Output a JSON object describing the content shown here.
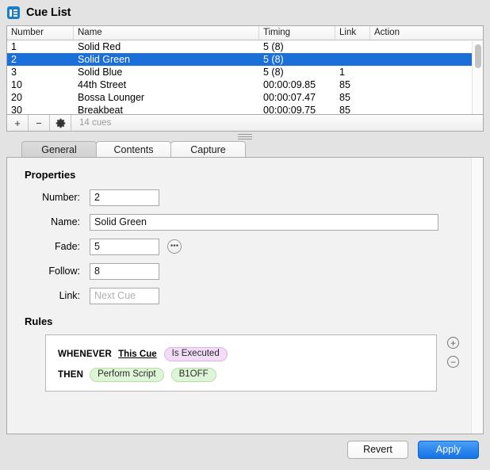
{
  "window": {
    "title": "Cue List",
    "icon": "list-icon"
  },
  "cue_table": {
    "columns": [
      {
        "key": "number",
        "label": "Number"
      },
      {
        "key": "name",
        "label": "Name"
      },
      {
        "key": "timing",
        "label": "Timing"
      },
      {
        "key": "link",
        "label": "Link"
      },
      {
        "key": "action",
        "label": "Action"
      }
    ],
    "rows": [
      {
        "number": "1",
        "name": "Solid Red",
        "timing": "5 (8)",
        "link": "",
        "action": "",
        "selected": false
      },
      {
        "number": "2",
        "name": "Solid Green",
        "timing": "5 (8)",
        "link": "",
        "action": "",
        "selected": true
      },
      {
        "number": "3",
        "name": "Solid Blue",
        "timing": "5 (8)",
        "link": "1",
        "action": "",
        "selected": false
      },
      {
        "number": "10",
        "name": "44th Street",
        "timing": "00:00:09.85",
        "link": "85",
        "action": "",
        "selected": false
      },
      {
        "number": "20",
        "name": "Bossa Lounger",
        "timing": "00:00:07.47",
        "link": "85",
        "action": "",
        "selected": false
      },
      {
        "number": "30",
        "name": "Breakbeat",
        "timing": "00:00:09.75",
        "link": "85",
        "action": "",
        "selected": false
      }
    ],
    "toolbar": {
      "add_label": "+",
      "remove_label": "−",
      "settings_icon": "gear-icon",
      "status": "14 cues"
    },
    "selection_color": "#1b6fd8"
  },
  "tabs": [
    {
      "label": "General",
      "active": true
    },
    {
      "label": "Contents",
      "active": false
    },
    {
      "label": "Capture",
      "active": false
    }
  ],
  "properties": {
    "heading": "Properties",
    "fields": [
      {
        "label": "Number:",
        "value": "2",
        "placeholder": "",
        "size": "small",
        "has_options": false
      },
      {
        "label": "Name:",
        "value": "Solid Green",
        "placeholder": "",
        "size": "wide",
        "has_options": false
      },
      {
        "label": "Fade:",
        "value": "5",
        "placeholder": "",
        "size": "small",
        "has_options": true
      },
      {
        "label": "Follow:",
        "value": "8",
        "placeholder": "",
        "size": "small",
        "has_options": false
      },
      {
        "label": "Link:",
        "value": "",
        "placeholder": "Next Cue",
        "size": "small",
        "has_options": false
      }
    ],
    "options_button_label": "•••"
  },
  "rules": {
    "heading": "Rules",
    "when_keyword": "WHENEVER",
    "when_target": "This Cue",
    "when_event": "Is Executed",
    "then_keyword": "THEN",
    "then_action": "Perform Script",
    "then_argument": "B1OFF",
    "add_label": "+",
    "remove_label": "−",
    "event_token_color": "#f3dcf7",
    "action_token_color": "#dff5d8"
  },
  "footer": {
    "revert_label": "Revert",
    "apply_label": "Apply",
    "apply_color": "#1473e6"
  }
}
